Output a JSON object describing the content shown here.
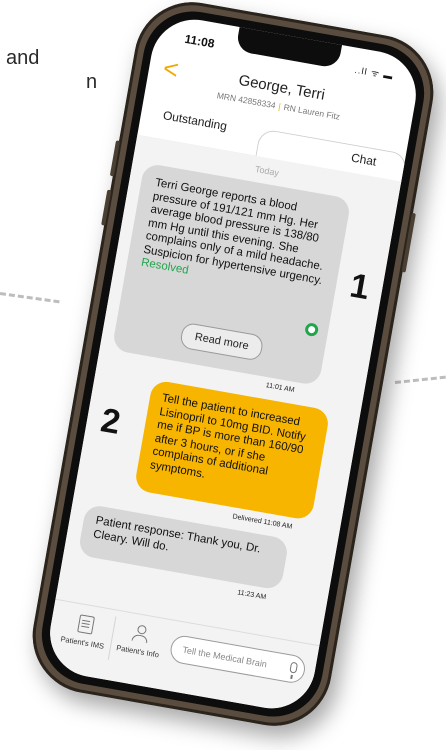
{
  "caption": {
    "line1": "and",
    "line2": "n"
  },
  "status_bar": {
    "time": "11:08",
    "icons": "..ll ᯤ ▬"
  },
  "header": {
    "back_glyph": "<",
    "patient_name": "George, Terri",
    "mrn": "MRN 42858334",
    "separator": "|",
    "nurse": "RN Lauren Fitz"
  },
  "tabs": {
    "outstanding": "Outstanding",
    "chat": "Chat"
  },
  "chat": {
    "date_separator": "Today",
    "messages": [
      {
        "number": "1",
        "text": "Terri George reports a blood pressure of 191/121 mm Hg. Her average blood pressure is 138/80 mm Hg until this evening. She complains only of a mild headache. Suspicion for hypertensive urgency.",
        "status": "Resolved",
        "button": "Read more",
        "time": "11:01 AM"
      },
      {
        "number": "2",
        "text": "Tell the patient to increased Lisinopril to 10mg BID. Notify me if BP is more than 160/90 after 3 hours, or if she complains of additional symptoms.",
        "time": "Delivered 11:08 AM"
      },
      {
        "text": "Patient response: Thank you, Dr. Cleary. Will do.",
        "time": "11:23 AM"
      }
    ]
  },
  "footer": {
    "ims_label": "Patient's IMS",
    "info_label": "Patient's Info",
    "input_placeholder": "Tell the Medical Brain"
  },
  "colors": {
    "accent": "#f7b500",
    "resolved": "#1fa64c",
    "bubble_gray": "#d7d7d7"
  },
  "icons": [
    "back-chevron-icon",
    "signal-wifi-battery-icon",
    "check-circle-icon",
    "clipboard-icon",
    "user-icon",
    "microphone-icon"
  ]
}
